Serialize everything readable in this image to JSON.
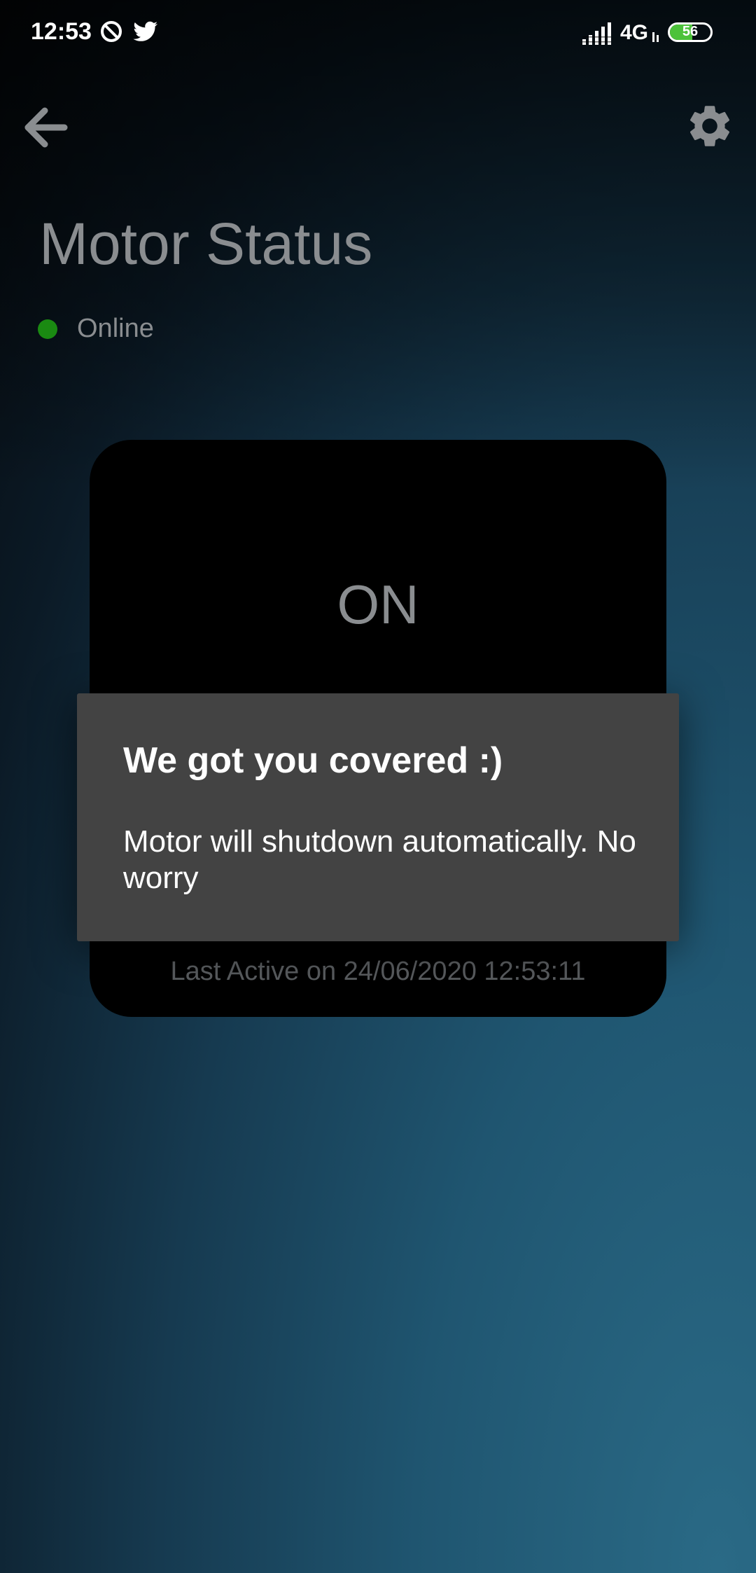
{
  "status_bar": {
    "time": "12:53",
    "network": "4G",
    "battery": "56",
    "battery_level": 0.56
  },
  "app_bar": {
    "back_icon": "back-arrow-icon",
    "settings_icon": "gear-icon"
  },
  "page": {
    "title": "Motor Status",
    "connection_status": "Online",
    "connection_color": "#1a8a12"
  },
  "motor_card": {
    "state": "ON",
    "last_active": "Last Active on 24/06/2020 12:53:11"
  },
  "dialog": {
    "title": "We got you covered :)",
    "message": "Motor will shutdown automatically. No worry"
  }
}
